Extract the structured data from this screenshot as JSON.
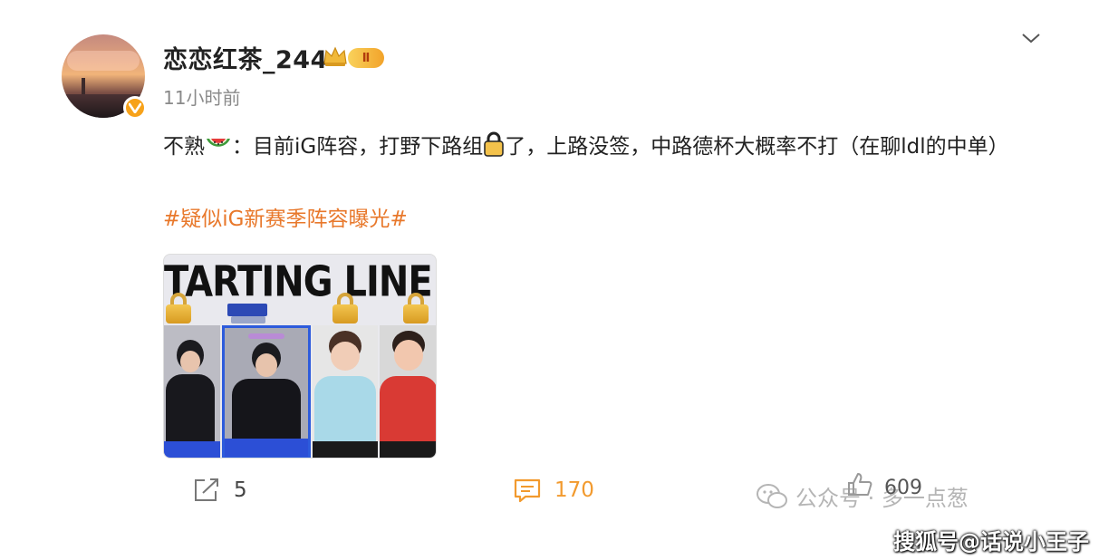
{
  "post": {
    "username": "恋恋红茶_244",
    "level_badge": "Ⅱ",
    "time": "11小时前",
    "text_part1": "不熟",
    "text_part2": "：目前iG阵容，打野下路组",
    "text_part3": "了，上路没签，中路德杯大概率不打（在聊ldl的中单）",
    "hashtag": "#疑似iG新赛季阵容曝光#",
    "image_title": "TARTING LINE UP"
  },
  "actions": {
    "repost_count": "5",
    "comment_count": "170",
    "like_count": "609"
  },
  "watermarks": {
    "wechat": "公众号 · 多一点葱",
    "sohu": "搜狐号@话说小王子"
  },
  "colors": {
    "hashtag": "#e8782b",
    "comment_icon": "#f29a2e",
    "verified": "#f7a21a",
    "badge": "#f2a32a"
  },
  "icons": [
    "avatar",
    "verified-icon",
    "crown-icon",
    "chevron-down-icon",
    "watermelon-icon",
    "lock-icon",
    "repost-icon",
    "comment-icon",
    "like-icon",
    "wechat-icon"
  ]
}
